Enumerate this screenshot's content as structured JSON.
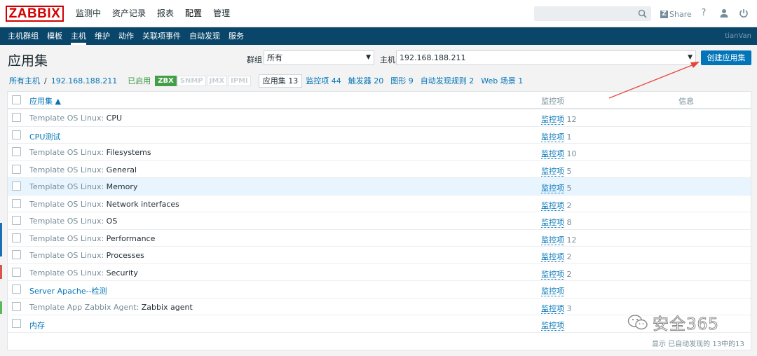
{
  "brand": {
    "logo": "ZABBIX"
  },
  "main_nav": [
    {
      "label": "监测中"
    },
    {
      "label": "资产记录"
    },
    {
      "label": "报表"
    },
    {
      "label": "配置",
      "active": true
    },
    {
      "label": "管理"
    }
  ],
  "header": {
    "search_placeholder": "",
    "share_label": "Share",
    "share_z": "Z",
    "help": "?",
    "user_icon": "user-icon",
    "power_icon": "power-icon"
  },
  "sub_nav": {
    "items": [
      {
        "label": "主机群组"
      },
      {
        "label": "模板"
      },
      {
        "label": "主机",
        "active": true
      },
      {
        "label": "维护"
      },
      {
        "label": "动作"
      },
      {
        "label": "关联项事件"
      },
      {
        "label": "自动发现"
      },
      {
        "label": "服务"
      }
    ],
    "user": "tianVan"
  },
  "page": {
    "title": "应用集",
    "group_label": "群组",
    "group_value": "所有",
    "host_label": "主机",
    "host_value": "192.168.188.211",
    "create_button": "创建应用集"
  },
  "host_row": {
    "all_hosts": "所有主机",
    "separator": "/",
    "host": "192.168.188.211",
    "status": "已启用",
    "badges": [
      "ZBX",
      "SNMP",
      "JMX",
      "IPMI"
    ],
    "current_tab": "应用集 13",
    "tabs": [
      "监控项 44",
      "触发器 20",
      "图形 9",
      "自动发现规则 2",
      "Web 场景 1"
    ]
  },
  "table": {
    "columns": [
      "应用集 ▲",
      "监控项",
      "信息"
    ],
    "rows": [
      {
        "template": "Template OS Linux:",
        "name": " CPU",
        "items": "监控项",
        "count": "12"
      },
      {
        "template": "",
        "name": "CPU测试",
        "items": "监控项",
        "count": "1",
        "link": true
      },
      {
        "template": "Template OS Linux:",
        "name": " Filesystems",
        "items": "监控项",
        "count": "10"
      },
      {
        "template": "Template OS Linux:",
        "name": " General",
        "items": "监控项",
        "count": "5"
      },
      {
        "template": "Template OS Linux:",
        "name": " Memory",
        "items": "监控项",
        "count": "5",
        "highlight": true
      },
      {
        "template": "Template OS Linux:",
        "name": " Network interfaces",
        "items": "监控项",
        "count": "2"
      },
      {
        "template": "Template OS Linux:",
        "name": " OS",
        "items": "监控项",
        "count": "8"
      },
      {
        "template": "Template OS Linux:",
        "name": " Performance",
        "items": "监控项",
        "count": "12"
      },
      {
        "template": "Template OS Linux:",
        "name": " Processes",
        "items": "监控项",
        "count": "2"
      },
      {
        "template": "Template OS Linux:",
        "name": " Security",
        "items": "监控项",
        "count": "2"
      },
      {
        "template": "",
        "name": "Server Apache--检测",
        "items": "监控项",
        "count": "",
        "link": true
      },
      {
        "template": "Template App Zabbix Agent:",
        "name": " Zabbix agent",
        "items": "监控项",
        "count": "3"
      },
      {
        "template": "",
        "name": "内存",
        "items": "监控项",
        "count": "",
        "link": true
      }
    ],
    "footer": "显示 已自动发现的 13中的13"
  },
  "watermark": {
    "text": "安全365"
  },
  "colors": {
    "brand_red": "#d40000",
    "subnav_bg": "#0a466a",
    "link_blue": "#0275b8",
    "enabled_green": "#429e47",
    "annotation_red": "#e5463b"
  }
}
